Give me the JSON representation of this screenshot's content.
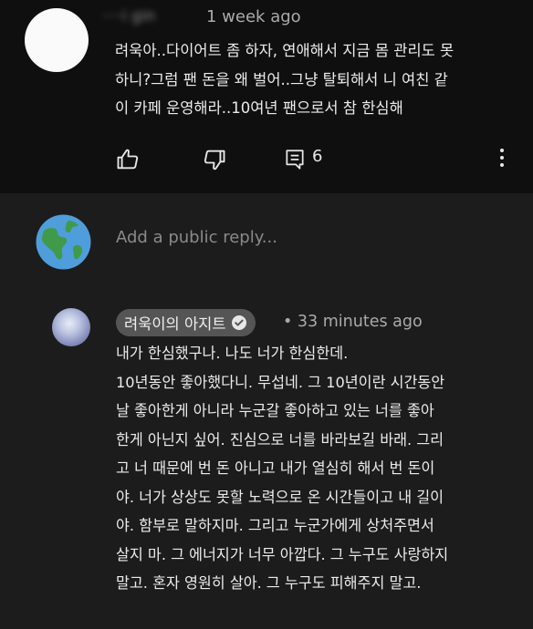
{
  "comment": {
    "author": "····i gin",
    "time": "1 week ago",
    "lines": [
      "려욱아..다이어트 좀 하자, 연애해서 지금 몸 관리도 못",
      "하니?그럼 팬 돈을 왜 벌어..그냥 탈퇴해서 니 여친 같",
      "이 카페 운영해라..10여년 팬으로서 참 한심해"
    ],
    "reply_count": "6",
    "icons": [
      "like-icon",
      "dislike-icon",
      "reply-icon",
      "more-vert-icon"
    ]
  },
  "reply_box": {
    "placeholder": "Add a public reply..."
  },
  "reply": {
    "author": "려욱이의 아지트",
    "separator": "•",
    "time": "33 minutes ago",
    "lines": [
      "내가 한심했구나. 나도 너가 한심한데.",
      "10년동안 좋아했다니. 무섭네. 그 10년이란 시간동안",
      "날 좋아한게 아니라 누군갈 좋아하고 있는 너를 좋아",
      "한게 아닌지 싶어. 진심으로 너를 바라보길 바래. 그리",
      "고 너 때문에 번 돈 아니고 내가 열심히 해서 번 돈이",
      "야. 너가 상상도 못할 노력으로 온 시간들이고 내 길이",
      "야. 함부로 말하지마. 그리고 누군가에게 상처주면서",
      "살지 마. 그 에너지가 너무 아깝다. 그 누구도 사랑하지",
      "말고. 혼자 영원히 살아. 그 누구도 피해주지 말고."
    ]
  }
}
